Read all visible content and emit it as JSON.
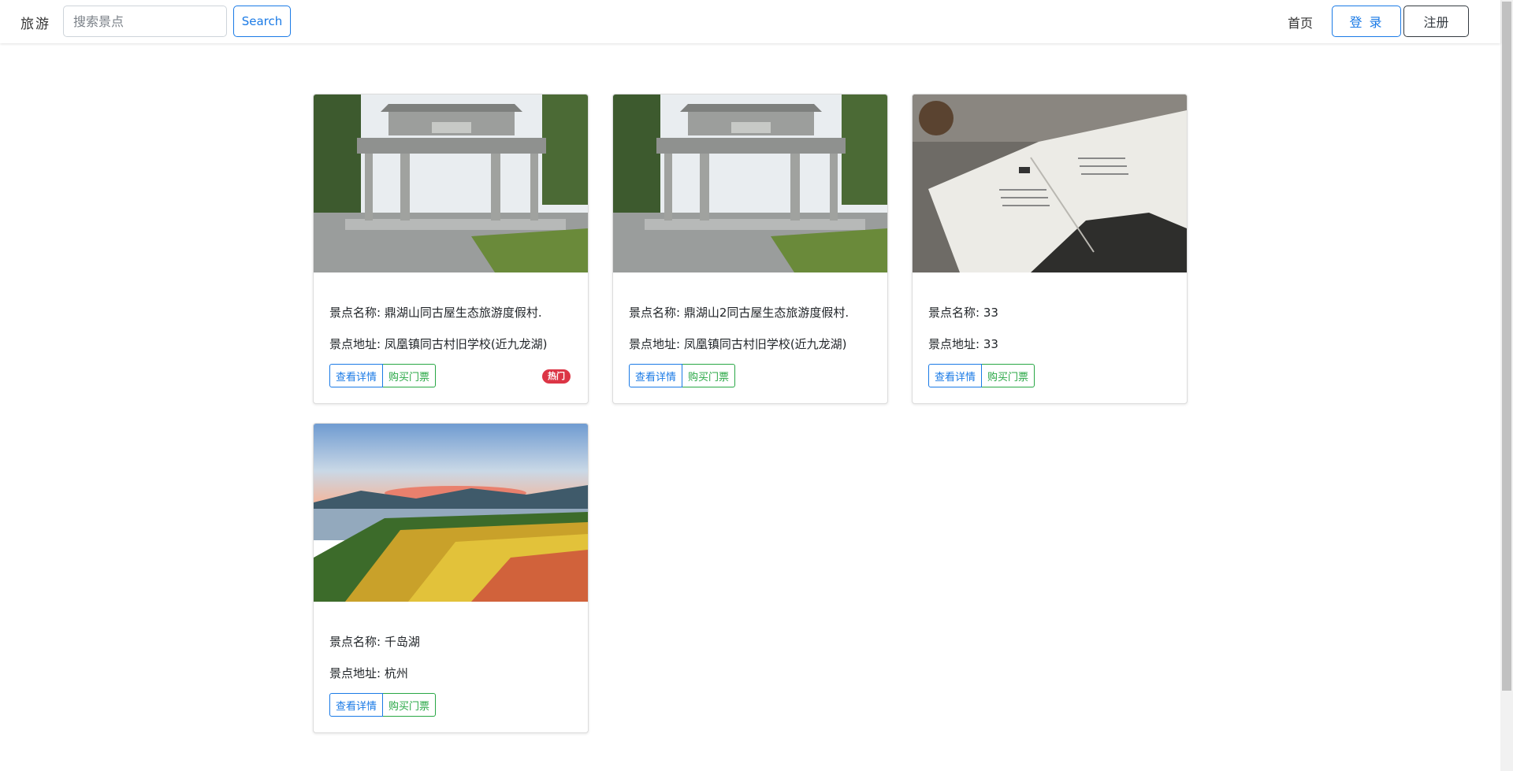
{
  "nav": {
    "brand": "旅游",
    "search_placeholder": "搜索景点",
    "search_label": "Search",
    "home_label": "首页",
    "login_label": "登 录",
    "register_label": "注册"
  },
  "cards": [
    {
      "name_prefix": "景点名称: ",
      "name": "鼎湖山同古屋生态旅游度假村.",
      "addr_prefix": "景点地址: ",
      "address": "凤凰镇同古村旧学校(近九龙湖)",
      "detail_label": "查看详情",
      "buy_label": "购买门票",
      "badge": "热门",
      "image": "archway-photo"
    },
    {
      "name_prefix": "景点名称: ",
      "name": "鼎湖山2同古屋生态旅游度假村.",
      "addr_prefix": "景点地址: ",
      "address": "凤凰镇同古村旧学校(近九龙湖)",
      "detail_label": "查看详情",
      "buy_label": "购买门票",
      "image": "archway-photo"
    },
    {
      "name_prefix": "景点名称: ",
      "name": "33",
      "addr_prefix": "景点地址: ",
      "address": "33",
      "detail_label": "查看详情",
      "buy_label": "购买门票",
      "image": "open-book-photo"
    },
    {
      "name_prefix": "景点名称: ",
      "name": "千岛湖",
      "addr_prefix": "景点地址: ",
      "address": "杭州",
      "detail_label": "查看详情",
      "buy_label": "购买门票",
      "image": "lake-flowers-photo"
    }
  ],
  "colors": {
    "primary": "#1a7ae6",
    "success": "#28a745",
    "danger": "#dc3545",
    "dark": "#343a40"
  }
}
